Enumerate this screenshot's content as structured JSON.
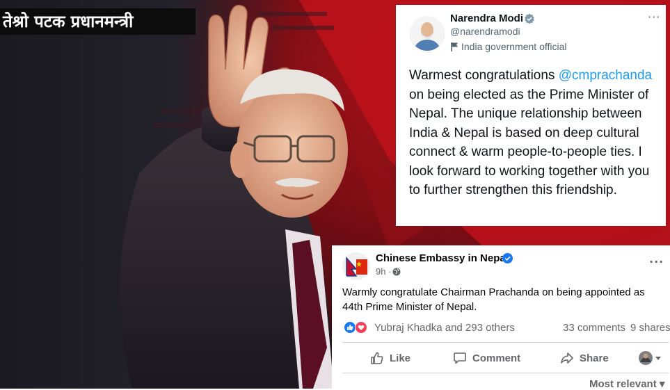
{
  "poster": {
    "headline": "तेश्रो पटक प्रधानमन्त्री"
  },
  "tweet": {
    "author_name": "Narendra Modi",
    "handle": "@narendramodi",
    "label": "India government official",
    "more_icon": "more-horizontal-icon",
    "verified_color": "#829aab",
    "mention": "@cmprachanda",
    "text_before": "Warmest congratulations ",
    "text_after": " on being elected as the Prime Minister of Nepal. The unique relationship between India & Nepal is based on deep cultural connect & warm people-to-people ties. I look forward to working together with you to further strengthen this friendship.",
    "mention_color": "#1d9bf0"
  },
  "facebook": {
    "page_name": "Chinese Embassy in Nepal",
    "time": "9h ·",
    "text": "Warmly congratulate Chairman Prachanda on being appointed as 44th Prime Minister of Nepal.",
    "reactors": "Yubraj Khadka and 293 others",
    "comments": "33 comments",
    "shares": "9 shares",
    "actions": {
      "like": "Like",
      "comment": "Comment",
      "share": "Share"
    },
    "sort": "Most relevant",
    "verified_color": "#1877f2",
    "icons": [
      "verified-badge-icon",
      "globe-icon",
      "like-reaction-icon",
      "love-reaction-icon",
      "thumbs-up-icon",
      "comment-bubble-icon",
      "share-arrow-icon",
      "chevron-down-icon"
    ]
  }
}
